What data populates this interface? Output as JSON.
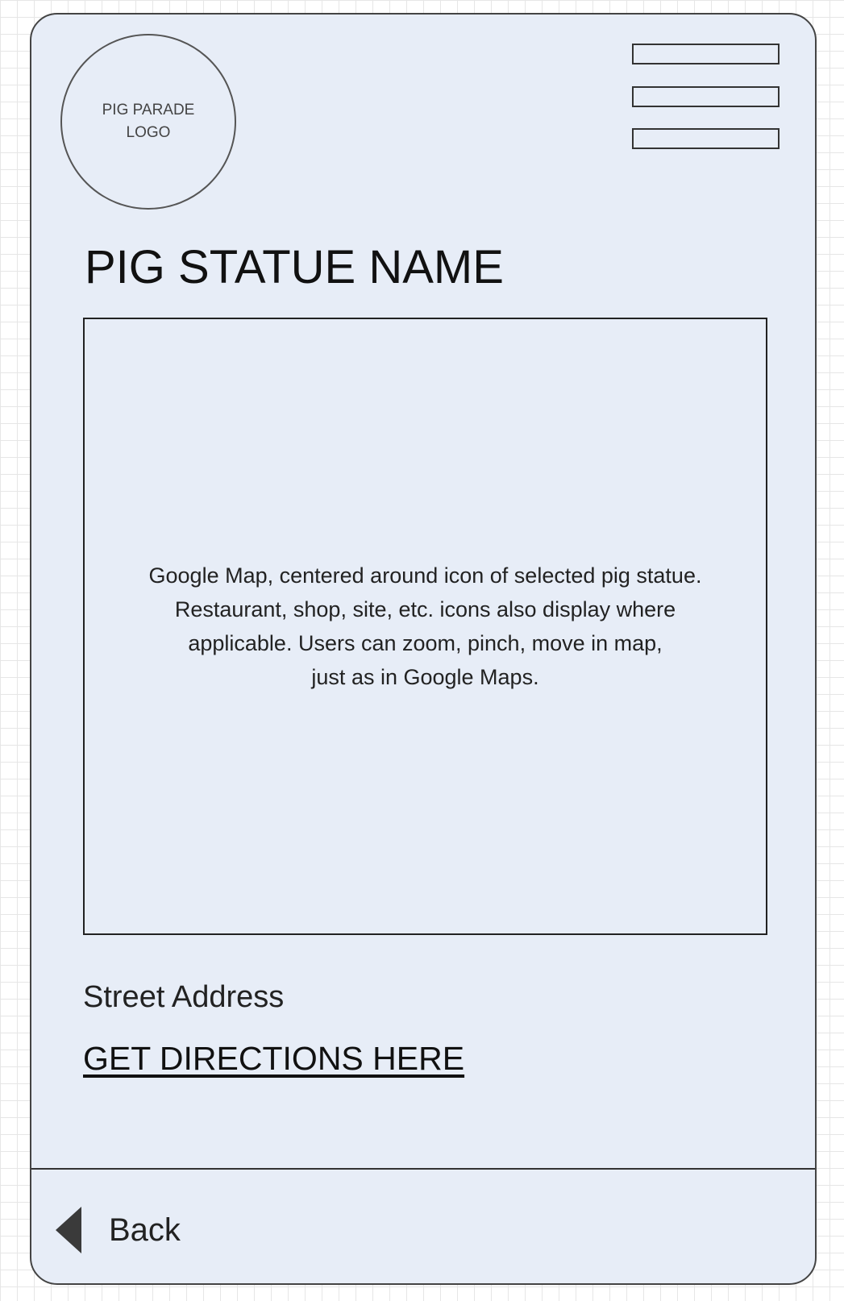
{
  "header": {
    "logo_text": "PIG PARADE\nLOGO",
    "menu_icon": "hamburger-menu-icon"
  },
  "page": {
    "title": "PIG STATUE NAME"
  },
  "map": {
    "description": "Google Map, centered around icon of selected pig statue.\nRestaurant, shop, site, etc. icons also display where\napplicable. Users can zoom, pinch, move in map,\njust as in Google Maps."
  },
  "details": {
    "street_address": "Street Address",
    "directions_link": "GET DIRECTIONS HERE"
  },
  "footer": {
    "back_icon": "triangle-left-icon",
    "back_label": "Back"
  },
  "colors": {
    "screen_background": "#e7edf7",
    "outline": "#333333",
    "grid": "#e6e6e6"
  }
}
